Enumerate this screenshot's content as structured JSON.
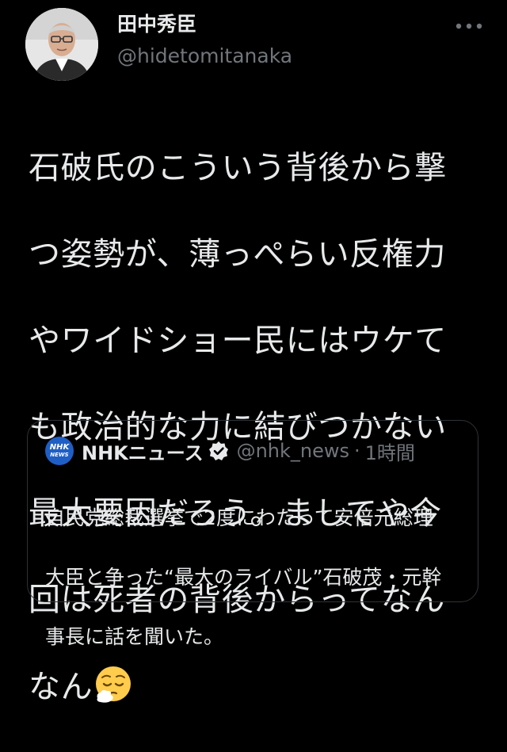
{
  "author": {
    "name": "田中秀臣",
    "handle": "@hidetomitanaka",
    "avatar_icon": "user-avatar"
  },
  "more_icon": "more-horizontal-icon",
  "tweet": {
    "lines": [
      "石破氏のこういう背後から撃",
      "つ姿勢が、薄っぺらい反権力",
      "やワイドショー民にはウケて",
      "も政治的な力に結びつかない",
      "最大要因だろう。ましてや今",
      "回は死者の背後からってなん",
      "なん"
    ],
    "emoji": "relieved-sleepy-face-emoji"
  },
  "quote": {
    "name": "NHKニュース",
    "logo_line1": "NHK",
    "logo_line2": "NEWS",
    "verified_icon": "verified-badge-icon",
    "handle": "@nhk_news",
    "separator": "·",
    "time": "1時間",
    "lines": [
      "自民党総裁選挙で2度にわたって安倍元総理",
      "大臣と争った“最大のライバル”石破茂・元幹",
      "事長に話を聞いた。"
    ]
  },
  "colors": {
    "background": "#000000",
    "text_primary": "#e7e9ea",
    "text_secondary": "#71767b",
    "border": "#2f3336",
    "nhk_blue": "#1f5fc5"
  }
}
